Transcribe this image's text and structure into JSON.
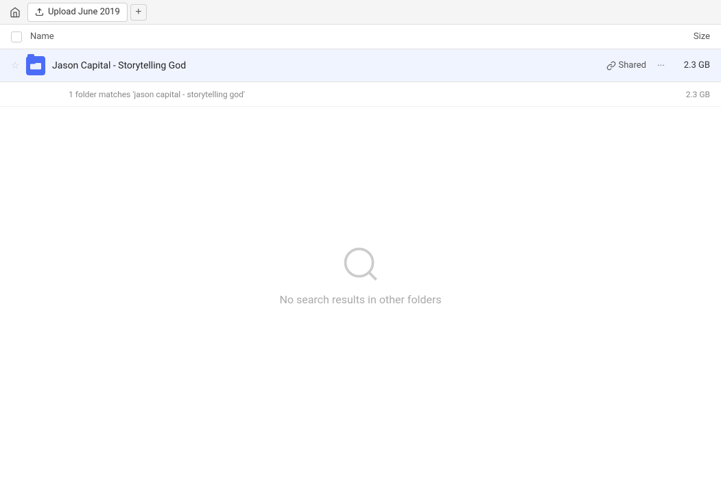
{
  "topbar": {
    "home_icon": "home",
    "tab_label": "Upload June 2019",
    "new_tab_icon": "+"
  },
  "table_header": {
    "name_label": "Name",
    "size_label": "Size"
  },
  "file_row": {
    "name": "Jason Capital - Storytelling God",
    "shared_label": "Shared",
    "size": "2.3 GB",
    "star_icon": "☆",
    "more_icon": "···",
    "link_icon": "🔗"
  },
  "match_info": {
    "text": "1 folder matches 'jason capital - storytelling god'",
    "size": "2.3 GB"
  },
  "empty_state": {
    "message": "No search results in other folders"
  }
}
